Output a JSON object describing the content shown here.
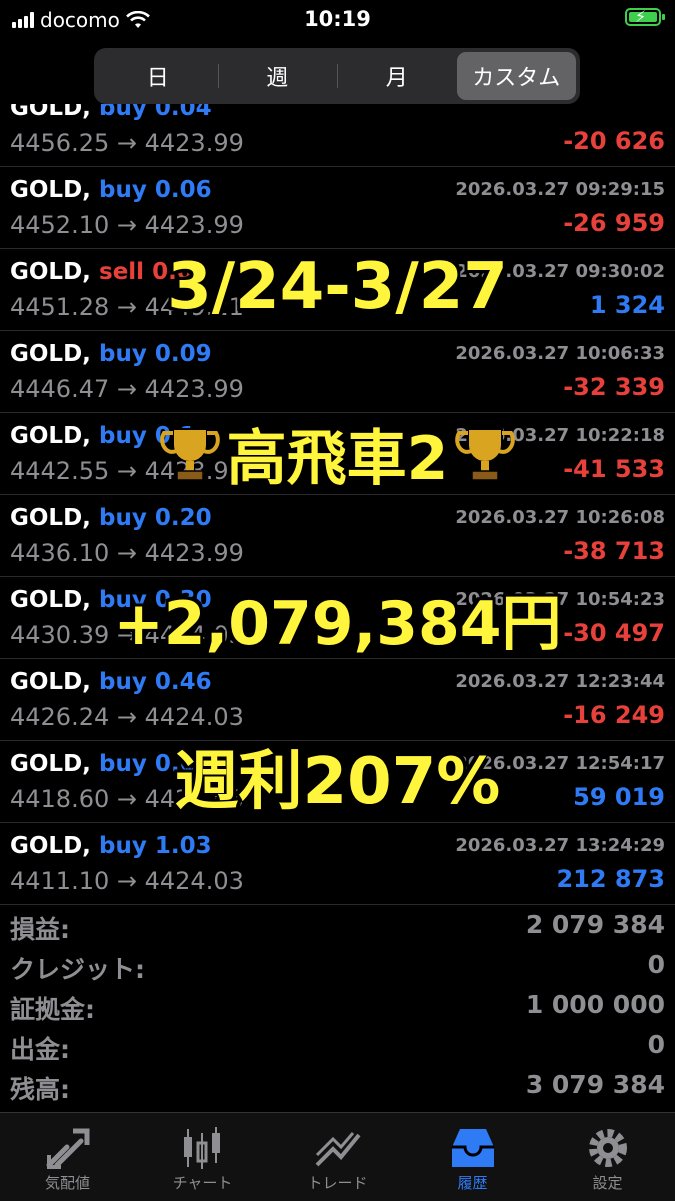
{
  "status_bar": {
    "carrier": "docomo",
    "time": "10:19"
  },
  "segments": [
    {
      "label": "日"
    },
    {
      "label": "週"
    },
    {
      "label": "月"
    },
    {
      "label": "カスタム",
      "active": true
    }
  ],
  "deals": [
    {
      "symbol": "GOLD,",
      "side": "buy 0.04",
      "prices": "4456.25 → 4423.99",
      "date": "",
      "profit": "-20 626"
    },
    {
      "symbol": "GOLD,",
      "side": "buy 0.06",
      "prices": "4452.10 → 4423.99",
      "date": "2026.03.27 09:29:15",
      "profit": "-26 959"
    },
    {
      "symbol": "GOLD,",
      "side": "sell 0.04",
      "prices": "4451.28 → 4449.21",
      "date": "2026.03.27 09:30:02",
      "profit": "1 324"
    },
    {
      "symbol": "GOLD,",
      "side": "buy 0.09",
      "prices": "4446.47 → 4423.99",
      "date": "2026.03.27 10:06:33",
      "profit": "-32 339"
    },
    {
      "symbol": "GOLD,",
      "side": "buy 0.1",
      "prices": "4442.55 → 4423.99",
      "date": "2026.03.27 10:22:18",
      "profit": "-41 533"
    },
    {
      "symbol": "GOLD,",
      "side": "buy 0.20",
      "prices": "4436.10 → 4423.99",
      "date": "2026.03.27 10:26:08",
      "profit": "-38 713"
    },
    {
      "symbol": "GOLD,",
      "side": "buy 0.30",
      "prices": "4430.39 → 4424.03",
      "date": "2026.03.27 10:54:23",
      "profit": "-30 497"
    },
    {
      "symbol": "GOLD,",
      "side": "buy 0.46",
      "prices": "4426.24 → 4424.03",
      "date": "2026.03.27 12:23:44",
      "profit": "-16 249"
    },
    {
      "symbol": "GOLD,",
      "side": "buy 0.68",
      "prices": "4418.60 → 4424.03",
      "date": "2026.03.27 12:54:17",
      "profit": "59 019"
    },
    {
      "symbol": "GOLD,",
      "side": "buy 1.03",
      "prices": "4411.10 → 4424.03",
      "date": "2026.03.27 13:24:29",
      "profit": "212 873"
    }
  ],
  "summary": [
    {
      "label": "損益:",
      "value": "2 079 384"
    },
    {
      "label": "クレジット:",
      "value": "0"
    },
    {
      "label": "証拠金:",
      "value": "1 000 000"
    },
    {
      "label": "出金:",
      "value": "0"
    },
    {
      "label": "残高:",
      "value": "3 079 384"
    }
  ],
  "overlay": {
    "date_range": "3/24-3/27",
    "title": "高飛車2",
    "profit": "+2,079,384円",
    "weekly": "週利207%"
  },
  "tabs": [
    {
      "label": "気配値",
      "icon": "quotes-icon"
    },
    {
      "label": "チャート",
      "icon": "chart-icon"
    },
    {
      "label": "トレード",
      "icon": "trade-icon"
    },
    {
      "label": "履歴",
      "icon": "history-icon",
      "active": true
    },
    {
      "label": "設定",
      "icon": "settings-icon"
    }
  ],
  "colors": {
    "buy": "#2f7bf6",
    "sell": "#e8413b",
    "overlay_text": "#fff53c",
    "battery": "#3ecf4c"
  }
}
